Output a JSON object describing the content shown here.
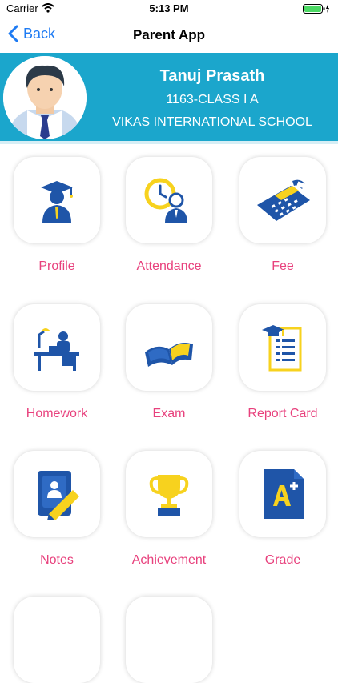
{
  "status_bar": {
    "carrier": "Carrier",
    "time": "5:13 PM"
  },
  "nav": {
    "back_label": "Back",
    "title": "Parent App"
  },
  "student": {
    "name": "Tanuj Prasath",
    "class": "1163-CLASS I A",
    "school": "VIKAS INTERNATIONAL SCHOOL"
  },
  "menu": {
    "items": [
      {
        "label": "Profile",
        "icon": "graduate-icon"
      },
      {
        "label": "Attendance",
        "icon": "clock-person-icon"
      },
      {
        "label": "Fee",
        "icon": "calculator-icon"
      },
      {
        "label": "Homework",
        "icon": "study-desk-icon"
      },
      {
        "label": "Exam",
        "icon": "open-book-icon"
      },
      {
        "label": "Report Card",
        "icon": "report-card-icon"
      },
      {
        "label": "Notes",
        "icon": "notes-icon"
      },
      {
        "label": "Achievement",
        "icon": "trophy-icon"
      },
      {
        "label": "Grade",
        "icon": "grade-icon"
      }
    ]
  },
  "colors": {
    "accent": "#1ba6cc",
    "label": "#e8417d",
    "icon_blue": "#1f55a8",
    "icon_yellow": "#f7d21e",
    "link": "#1e7bf3"
  }
}
